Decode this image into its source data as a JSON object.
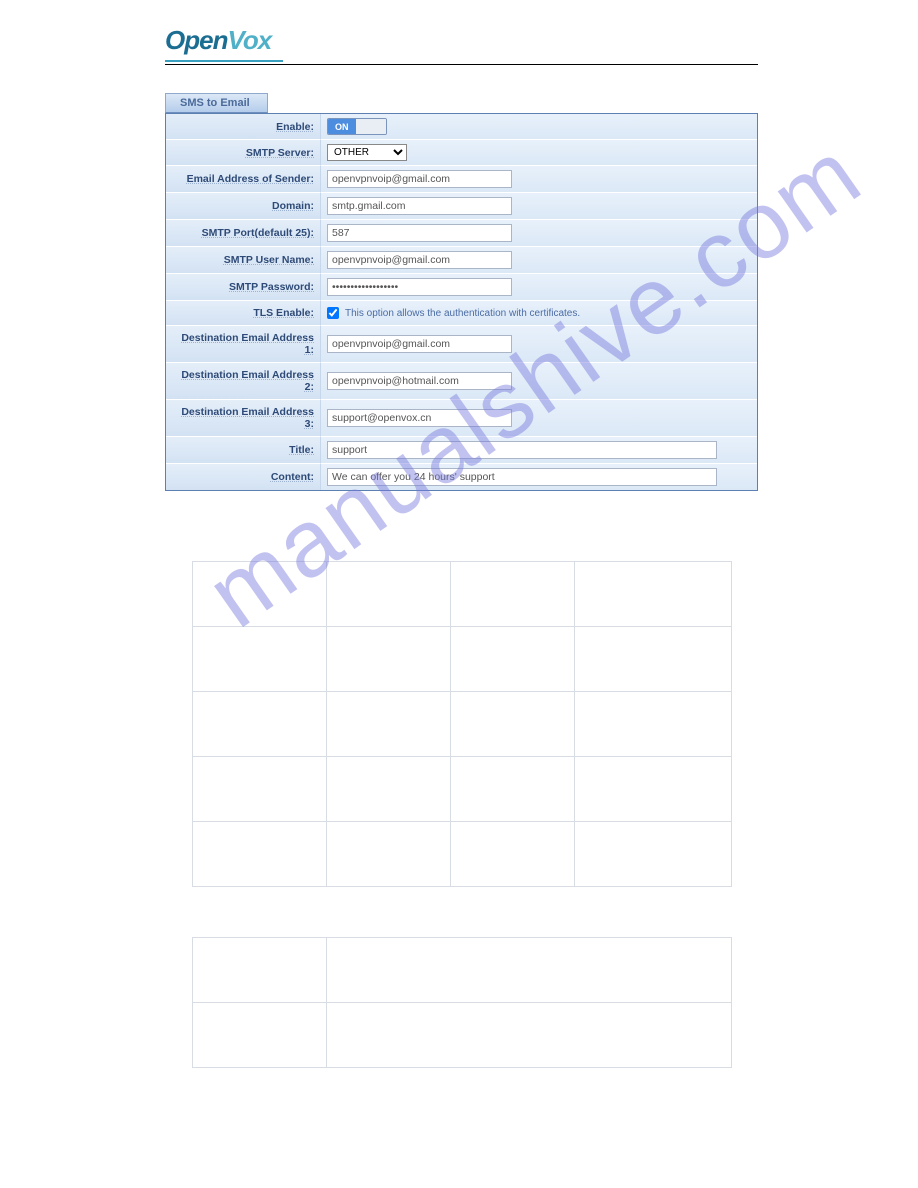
{
  "logo": {
    "part1": "Open",
    "part2": "Vox"
  },
  "tab": {
    "label": "SMS to Email"
  },
  "fields": {
    "enable": {
      "label": "Enable:",
      "state": "ON"
    },
    "smtp_server": {
      "label": "SMTP Server:",
      "selected": "OTHER",
      "options": [
        "OTHER"
      ]
    },
    "sender": {
      "label": "Email Address of Sender:",
      "value": "openvpnvoip@gmail.com"
    },
    "domain": {
      "label": "Domain:",
      "value": "smtp.gmail.com"
    },
    "port": {
      "label": "SMTP Port(default 25):",
      "value": "587"
    },
    "user": {
      "label": "SMTP User Name:",
      "value": "openvpnvoip@gmail.com"
    },
    "password": {
      "label": "SMTP Password:",
      "value": "••••••••••••••••••"
    },
    "tls": {
      "label": "TLS Enable:",
      "checked": true,
      "note": "This option allows the authentication with certificates."
    },
    "dest1": {
      "label": "Destination Email Address 1:",
      "value": "openvpnvoip@gmail.com"
    },
    "dest2": {
      "label": "Destination Email Address 2:",
      "value": "openvpnvoip@hotmail.com"
    },
    "dest3": {
      "label": "Destination Email Address 3:",
      "value": "support@openvox.cn"
    },
    "title": {
      "label": "Title:",
      "value": "support"
    },
    "content": {
      "label": "Content:",
      "value": "We can offer you 24 hours' support"
    }
  },
  "watermark": "manualshive.com"
}
